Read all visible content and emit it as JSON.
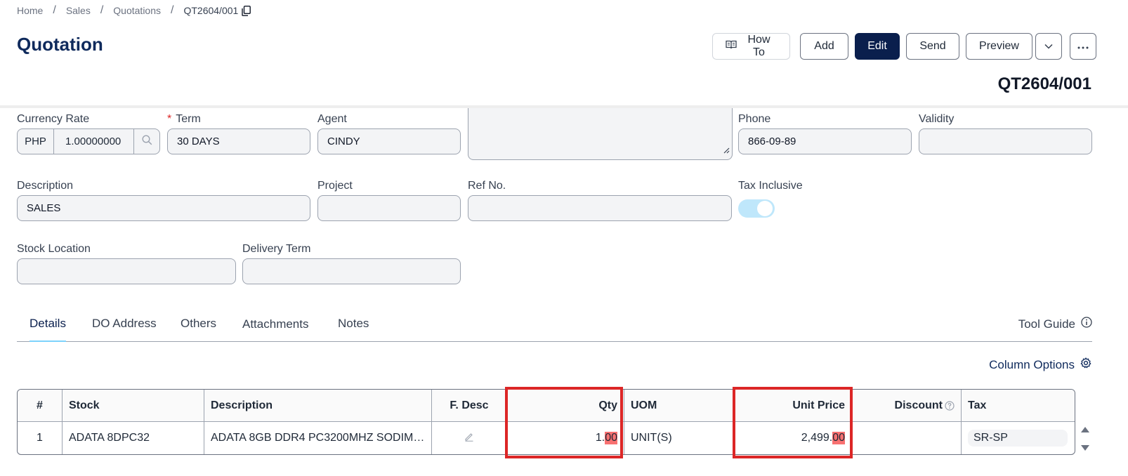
{
  "breadcrumb": {
    "home": "Home",
    "sales": "Sales",
    "quotations": "Quotations",
    "current": "QT2604/001"
  },
  "page": {
    "title": "Quotation",
    "doc_no": "QT2604/001"
  },
  "toolbar": {
    "howto": "How To",
    "add": "Add",
    "edit": "Edit",
    "send": "Send",
    "preview": "Preview"
  },
  "form": {
    "currency_rate": {
      "label": "Currency Rate",
      "currency": "PHP",
      "rate": "1.00000000"
    },
    "term": {
      "label": "Term",
      "required_mark": "*",
      "value": "30 DAYS"
    },
    "agent": {
      "label": "Agent",
      "value": "CINDY"
    },
    "phone": {
      "label": "Phone",
      "value": "866-09-89"
    },
    "validity": {
      "label": "Validity",
      "value": ""
    },
    "description": {
      "label": "Description",
      "value": "SALES"
    },
    "project": {
      "label": "Project",
      "value": ""
    },
    "ref_no": {
      "label": "Ref No.",
      "value": ""
    },
    "tax_inclusive": {
      "label": "Tax Inclusive",
      "on": true
    },
    "stock_location": {
      "label": "Stock Location",
      "value": ""
    },
    "delivery_term": {
      "label": "Delivery Term",
      "value": ""
    }
  },
  "tabs": [
    {
      "label": "Details",
      "active": true
    },
    {
      "label": "DO Address"
    },
    {
      "label": "Others"
    },
    {
      "label": "Attachments"
    },
    {
      "label": "Notes"
    }
  ],
  "tool_guide": "Tool Guide",
  "column_options": "Column Options",
  "table": {
    "headers": {
      "num": "#",
      "stock": "Stock",
      "description": "Description",
      "fdesc": "F. Desc",
      "qty": "Qty",
      "uom": "UOM",
      "unit_price": "Unit Price",
      "discount": "Discount",
      "tax": "Tax"
    },
    "rows": [
      {
        "num": "1",
        "stock": "ADATA 8DPC32",
        "description": "ADATA 8GB DDR4 PC3200MHZ SODIMM ...",
        "qty_int": "1.",
        "qty_dec": "00",
        "uom": "UNIT(S)",
        "price_int": "2,499.",
        "price_dec": "00",
        "discount": "",
        "tax": "SR-SP"
      }
    ]
  },
  "colors": {
    "primary": "#0a1f4d",
    "title": "#0f2a5c",
    "highlight_box": "#dc2626",
    "toggle_on": "#bfe7fb"
  }
}
